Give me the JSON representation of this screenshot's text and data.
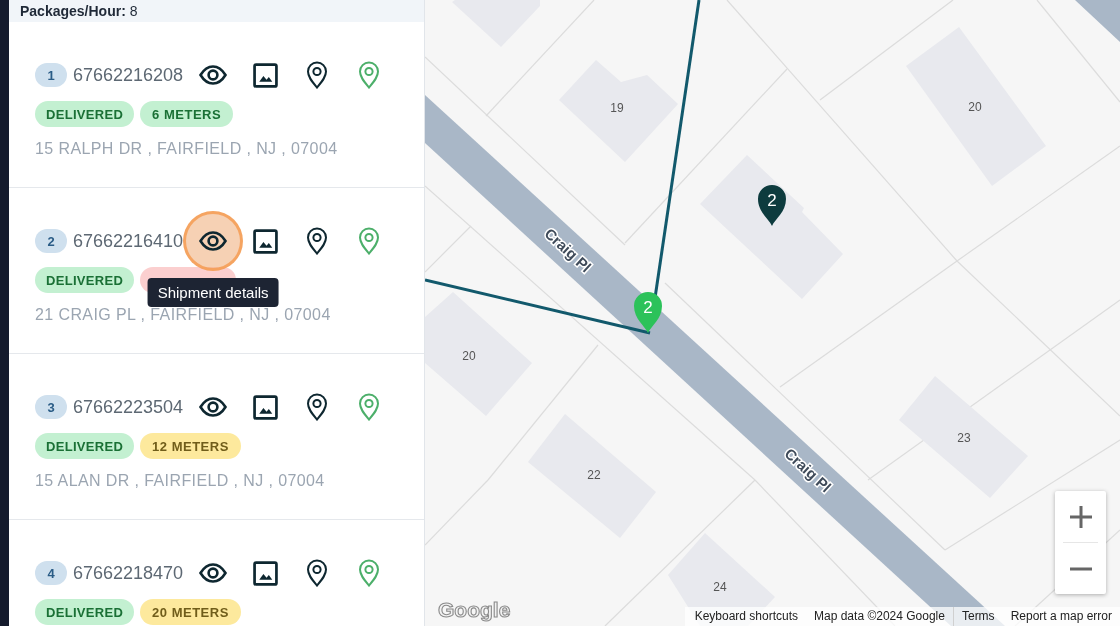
{
  "sidebar": {
    "header": "**Packages/Hour:** 8",
    "cards": [
      {
        "number": "1",
        "tracking": "67662216208",
        "details_pressed": false,
        "badges": [
          {
            "kind": "status",
            "text": "DELIVERED",
            "color": "#c3f0d1"
          },
          {
            "kind": "distance",
            "text": "6 METERS",
            "color": "#c3f0d1"
          }
        ],
        "address": "15 RALPH DR , FAIRFIELD , NJ , 07004"
      },
      {
        "number": "2",
        "tracking": "67662216410",
        "details_pressed": true,
        "details_tooltip": "Shipment details",
        "badges": [
          {
            "kind": "status",
            "text": "DELIVERED",
            "color": "#c3f0d1"
          },
          {
            "kind": "distance",
            "color": "#fbcfcf"
          }
        ],
        "address": "21 CRAIG PL , FAIRFIELD , NJ , 07004"
      },
      {
        "number": "3",
        "tracking": "67662223504",
        "details_pressed": false,
        "badges": [
          {
            "kind": "status",
            "text": "DELIVERED",
            "color": "#c3f0d1"
          },
          {
            "kind": "distance",
            "text": "12 METERS",
            "color": "#fde99d"
          }
        ],
        "address": "15 ALAN DR , FAIRFIELD , NJ , 07004"
      },
      {
        "number": "4",
        "tracking": "67662218470",
        "details_pressed": false,
        "badges": [
          {
            "kind": "status",
            "text": "DELIVERED",
            "color": "#c3f0d1"
          },
          {
            "kind": "distance",
            "text": "20 METERS",
            "color": "#fde99d"
          }
        ]
      }
    ]
  },
  "map": {
    "street_labels": [
      "Craig Pl",
      "Craig Pl"
    ],
    "house_numbers": [
      "19",
      "20",
      "20",
      "22",
      "23",
      "24"
    ],
    "markers": [
      {
        "label": "2",
        "color": "#2cc25a"
      },
      {
        "label": "2",
        "color": "#0d3b3e"
      }
    ],
    "logo": "Google",
    "attribution": [
      "Keyboard shortcuts",
      "Map data ©2024 Google",
      "Terms",
      "Report a map error"
    ]
  }
}
